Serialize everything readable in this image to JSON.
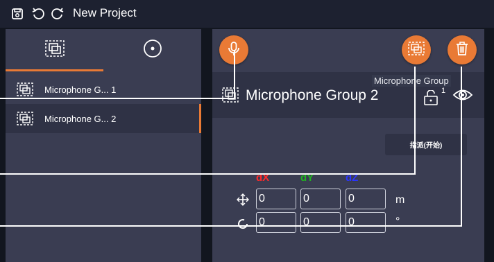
{
  "app": {
    "title": "New Project"
  },
  "toolbar": {
    "save": "save-icon",
    "undo": "undo-icon",
    "redo": "redo-icon"
  },
  "left_panel": {
    "tabs": [
      {
        "icon": "microphone-group-icon",
        "active": true
      },
      {
        "icon": "target-icon",
        "active": false
      }
    ],
    "items": [
      {
        "label": "Microphone G... 1",
        "selected": false
      },
      {
        "label": "Microphone G... 2",
        "selected": true
      }
    ]
  },
  "right_panel": {
    "title": "Microphone Group 2",
    "lock_count": "1",
    "tooltip": "Microphone Group",
    "assign_button": "指派(开始)",
    "axes": {
      "x": "dX",
      "y": "dY",
      "z": "dZ"
    },
    "position": {
      "x": "0",
      "y": "0",
      "z": "0",
      "unit": "m"
    },
    "rotation": {
      "x": "0",
      "y": "0",
      "z": "0",
      "unit": "°"
    }
  },
  "colors": {
    "accent": "#e97a35",
    "panel": "#3a3d52",
    "panel_dark": "#2f3245",
    "axis_x": "#ff2a2a",
    "axis_y": "#1fb51f",
    "axis_z": "#2a35ff"
  }
}
